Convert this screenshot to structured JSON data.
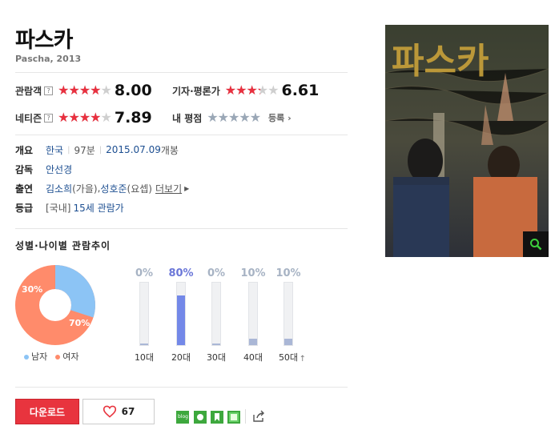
{
  "movie": {
    "title": "파스카",
    "subtitle": "Pascha, 2013"
  },
  "ratings": {
    "audience": {
      "label": "관람객",
      "help": "?",
      "score": "8.00",
      "fill": 0.8
    },
    "critics": {
      "label": "기자·평론가",
      "score": "6.61",
      "fill": 0.66
    },
    "netizen": {
      "label": "네티즌",
      "help": "?",
      "score": "7.89",
      "fill": 0.79
    },
    "mine": {
      "label": "내 평점",
      "register": "등록"
    }
  },
  "star_glyphs": "★★★★★",
  "info": {
    "overview_label": "개요",
    "country": "한국",
    "runtime": "97분",
    "release_date": "2015.07.09",
    "release_suffix": " 개봉",
    "director_label": "감독",
    "director": "안선경",
    "cast_label": "출연",
    "cast1_name": "김소희",
    "cast1_role": "(가을)",
    "cast_comma": ", ",
    "cast2_name": "성호준",
    "cast2_role": "(요셉)",
    "more": "더보기",
    "grade_label": "등급",
    "grade_region": "[국내]",
    "grade": "15세 관람가"
  },
  "trend": {
    "title": "성별·나이별 관람추이",
    "gender": {
      "male_label": "남자",
      "female_label": "여자",
      "male_pct": "30%",
      "female_pct": "70%",
      "male_value": 30,
      "female_value": 70,
      "male_color": "#8cc4f5",
      "female_color": "#ff8b6b"
    },
    "ages": [
      {
        "label": "10대",
        "pct": "0%",
        "value": 0
      },
      {
        "label": "20대",
        "pct": "80%",
        "value": 80
      },
      {
        "label": "30대",
        "pct": "0%",
        "value": 0
      },
      {
        "label": "40대",
        "pct": "10%",
        "value": 10
      },
      {
        "label": "50대",
        "pct": "10%",
        "value": 10
      }
    ]
  },
  "actions": {
    "download": "다운로드",
    "like_count": "67",
    "share_icons": [
      "blog",
      "cafe",
      "bookmark",
      "memo"
    ]
  },
  "poster": {
    "title_text": "파스카"
  }
}
